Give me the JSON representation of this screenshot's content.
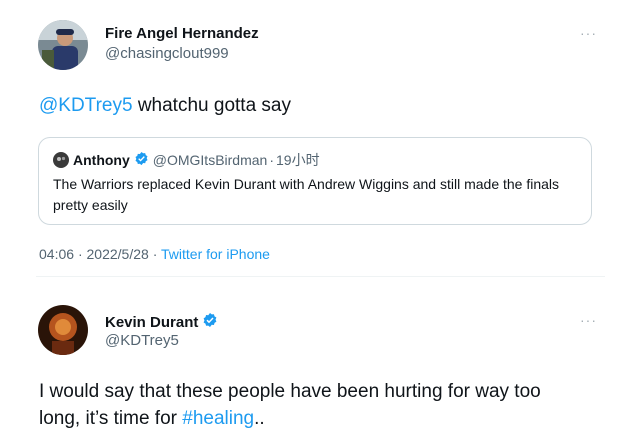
{
  "tweet1": {
    "name": "Fire Angel Hernandez",
    "handle": "@chasingclout999",
    "more": "···",
    "mention": "@KDTrey5",
    "text": " whatchu gotta say",
    "quote": {
      "name": "Anthony",
      "handle": "@OMGItsBirdman",
      "sep": "·",
      "time": "19小时",
      "text": "The Warriors replaced Kevin Durant with Andrew Wiggins and still made the finals pretty easily"
    },
    "time": "04:06",
    "dot1": "·",
    "date": "2022/5/28",
    "dot2": "·",
    "source": "Twitter for iPhone"
  },
  "tweet2": {
    "name": "Kevin Durant",
    "handle": "@KDTrey5",
    "more": "···",
    "text_line1": "I would say that these people have been hurting for way too",
    "text_line2_start": "long, it’s time for ",
    "hashtag": "#healing",
    "text_end": ".."
  },
  "colors": {
    "link": "#1d9bf0",
    "secondary_text": "#536471",
    "verified": "#1d9bf0",
    "border": "#cfd9de"
  }
}
